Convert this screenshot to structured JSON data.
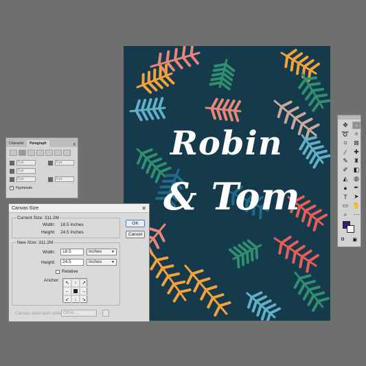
{
  "artboard": {
    "name_line1": "Robin",
    "name_line2": "& Tom",
    "background": "#153a4c",
    "palette": [
      "#e8867a",
      "#f4a23c",
      "#2f8f6e",
      "#5fb0c8",
      "#c9a89b",
      "#e85d57",
      "#1f6c8a"
    ]
  },
  "paragraph_panel": {
    "tabs": [
      "Character",
      "Paragraph"
    ],
    "active_tab": "Paragraph",
    "menu_icon": "panel-menu-icon",
    "fields": [
      "0 pt",
      "0 pt",
      "0 pt",
      "0 pt",
      "0 pt"
    ],
    "hyphenate_label": "Hyphenate",
    "hyphenate_checked": true
  },
  "canvas_dialog": {
    "title": "Canvas Size",
    "close_label": "✕",
    "current_size_label": "Current Size: 311.2M",
    "current_width_label": "Width:",
    "current_width_value": "18.5 Inches",
    "current_height_label": "Height:",
    "current_height_value": "24.5 Inches",
    "new_size_label": "New Size: 311.2M",
    "width_label": "Width:",
    "width_value": "18.5",
    "width_unit": "Inches",
    "height_label": "Height:",
    "height_value": "24.5",
    "height_unit": "Inches",
    "relative_label": "Relative",
    "relative_checked": false,
    "anchor_label": "Anchor:",
    "anchor_arrows": [
      "↖",
      "↑",
      "↗",
      "←",
      "",
      "→",
      "↙",
      "↓",
      "↘"
    ],
    "ok_label": "OK",
    "cancel_label": "Cancel",
    "extension_label": "Canvas extension color:",
    "extension_value": "Other..."
  },
  "toolbar": {
    "tools": [
      {
        "icon": "move-icon",
        "glyph": "✥"
      },
      {
        "icon": "marquee-icon",
        "glyph": "⬚",
        "active": true
      },
      {
        "icon": "lasso-icon",
        "glyph": "➰"
      },
      {
        "icon": "magic-wand-icon",
        "glyph": "✧"
      },
      {
        "icon": "crop-icon",
        "glyph": "⌗"
      },
      {
        "icon": "frame-icon",
        "glyph": "⊠"
      },
      {
        "icon": "eyedropper-icon",
        "glyph": "⁄"
      },
      {
        "icon": "healing-icon",
        "glyph": "✚"
      },
      {
        "icon": "brush-icon",
        "glyph": "✎"
      },
      {
        "icon": "stamp-icon",
        "glyph": "♜"
      },
      {
        "icon": "history-brush-icon",
        "glyph": "✐"
      },
      {
        "icon": "eraser-icon",
        "glyph": "◧"
      },
      {
        "icon": "bucket-icon",
        "glyph": "◭"
      },
      {
        "icon": "blur-icon",
        "glyph": "◍"
      },
      {
        "icon": "dodge-icon",
        "glyph": "●"
      },
      {
        "icon": "pen-icon",
        "glyph": "✒"
      },
      {
        "icon": "type-icon",
        "glyph": "T"
      },
      {
        "icon": "path-select-icon",
        "glyph": "➤"
      },
      {
        "icon": "shape-icon",
        "glyph": "▭"
      },
      {
        "icon": "hand-icon",
        "glyph": "✋"
      },
      {
        "icon": "zoom-icon",
        "glyph": "⌕"
      },
      {
        "icon": "more-icon",
        "glyph": "⋯"
      }
    ],
    "foreground_color": "#3a1c6e",
    "background_color": "#ffffff",
    "quick_mask_glyph": "◘",
    "screen_mode_glyph": "▣"
  }
}
